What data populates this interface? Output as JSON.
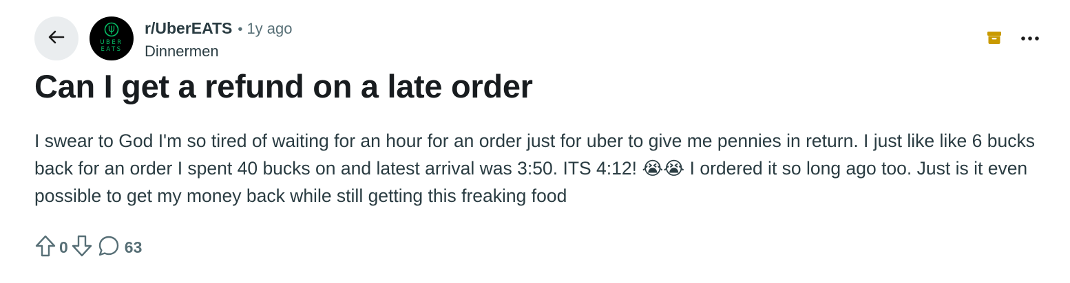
{
  "post": {
    "subreddit": "r/UberEATS",
    "separator": "•",
    "time": "1y ago",
    "author": "Dinnermen",
    "title": "Can I get a refund on a late order",
    "body": "I swear to God I'm so tired of waiting for an hour for an order just for uber to give me pennies in return. I just like like 6 bucks back for an order I spent 40 bucks on and latest arrival was 3:50. ITS 4:12! 😭😭 I ordered it so long ago too. Just is it even possible to get my money back while still getting this freaking food",
    "upvotes": "0",
    "comments": "63"
  },
  "avatar": {
    "line1": "UBER",
    "line2": "EATS"
  },
  "icons": {
    "back": "arrow-left-icon",
    "archive": "archive-icon",
    "more": "more-horizontal-icon",
    "upvote": "upvote-arrow-icon",
    "downvote": "downvote-arrow-icon",
    "comment": "comment-bubble-icon"
  },
  "colors": {
    "back_bg": "#eaedef",
    "avatar_bg": "#000000",
    "brand_green": "#06c167",
    "archive_gold": "#c99a00",
    "meta_gray": "#576f76",
    "text": "#2a3c42"
  }
}
